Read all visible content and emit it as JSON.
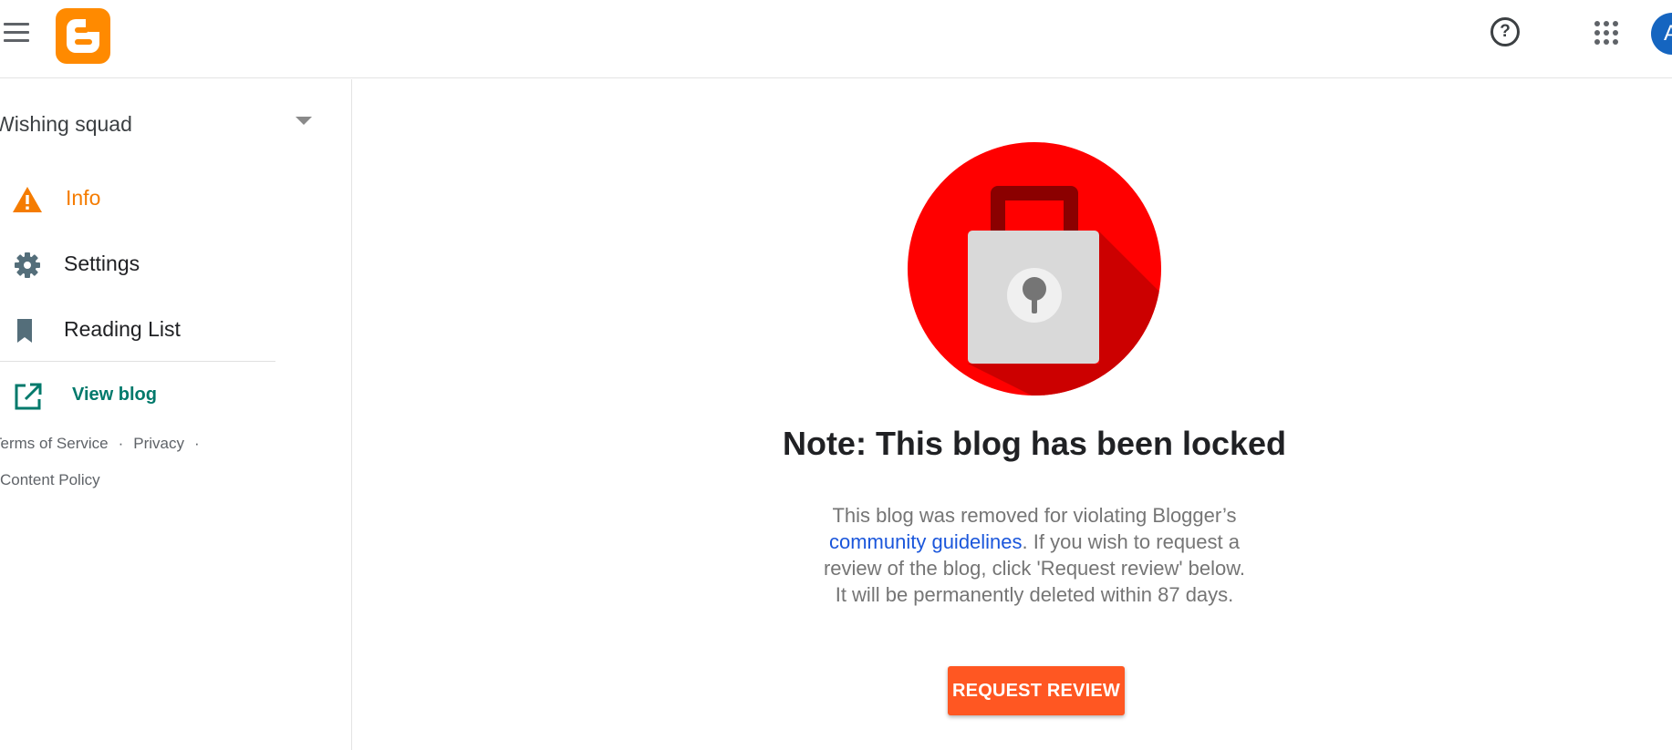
{
  "header": {
    "menu_icon": "hamburger-menu-icon",
    "logo_icon": "blogger-logo",
    "help_icon": "help-icon",
    "apps_icon": "apps-grid-icon",
    "avatar_letter": "A",
    "avatar_color": "#1565c0"
  },
  "sidebar": {
    "blog_name": "Wishing squad",
    "items": [
      {
        "label": "Info",
        "icon": "warning-icon",
        "active": true
      },
      {
        "label": "Settings",
        "icon": "gear-icon",
        "active": false
      },
      {
        "label": "Reading List",
        "icon": "bookmark-icon",
        "active": false
      }
    ],
    "view_blog": {
      "label": "View blog",
      "icon": "open-in-new-icon"
    },
    "footer": {
      "terms": "Terms of Service",
      "privacy": "Privacy",
      "separator": "·",
      "content_policy": "Content Policy"
    }
  },
  "main": {
    "illustration_icon": "padlock-icon",
    "title": "Note: This blog has been locked",
    "body_part1": "This blog was removed for violating Blogger’s ",
    "guidelines_link": "community guidelines",
    "body_part2": ". If you wish to request a review of the blog, click 'Request review' below. It will be permanently deleted within 87 days.",
    "request_button": "REQUEST REVIEW"
  },
  "colors": {
    "accent_orange": "#f57c00",
    "brand_blogger": "#ff8a00",
    "view_blog_teal": "#00796b",
    "link_blue": "#1a56db",
    "button_orange": "#ff5722",
    "lock_red": "#ff0000"
  }
}
